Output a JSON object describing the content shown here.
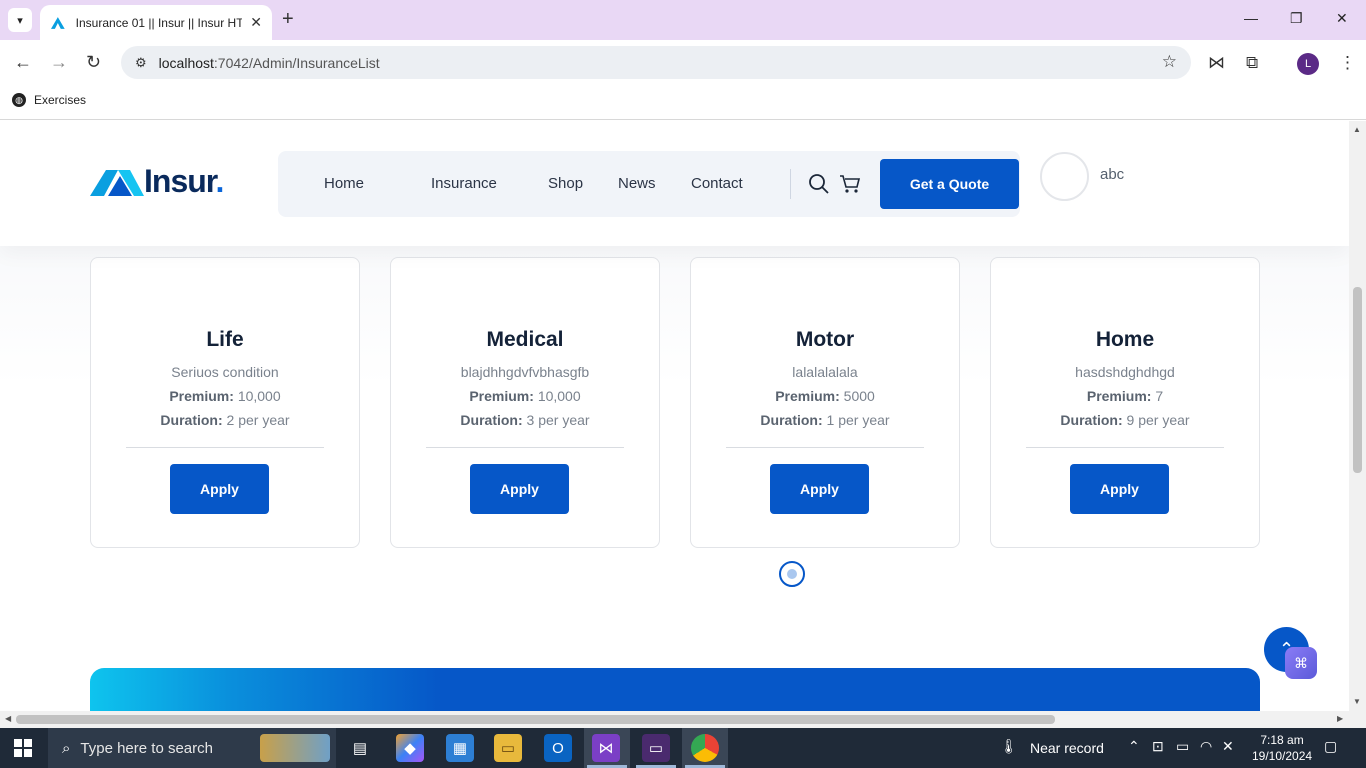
{
  "browser": {
    "tab_title": "Insurance 01 || Insur || Insur HTML",
    "url_host": "localhost",
    "url_path": ":7042/Admin/InsuranceList",
    "bookmark": "Exercises",
    "profile_initial": "L"
  },
  "site": {
    "logo_text": "Insur",
    "logo_dot": ".",
    "nav": [
      "Home",
      "Insurance",
      "Shop",
      "News",
      "Contact"
    ],
    "quote_button": "Get a Quote",
    "username": "abc"
  },
  "cards": [
    {
      "title": "Life",
      "desc": "Seriuos condition",
      "premium_label": "Premium:",
      "premium": "10,000",
      "duration_label": "Duration:",
      "duration": "2 per year",
      "button": "Apply"
    },
    {
      "title": "Medical",
      "desc": "blajdhhgdvfvbhasgfb",
      "premium_label": "Premium:",
      "premium": "10,000",
      "duration_label": "Duration:",
      "duration": "3 per year",
      "button": "Apply"
    },
    {
      "title": "Motor",
      "desc": "lalalalalala",
      "premium_label": "Premium:",
      "premium": "5000",
      "duration_label": "Duration:",
      "duration": "1 per year",
      "button": "Apply"
    },
    {
      "title": "Home",
      "desc": "hasdshdghdhgd",
      "premium_label": "Premium:",
      "premium": "7",
      "duration_label": "Duration:",
      "duration": "9 per year",
      "button": "Apply"
    }
  ],
  "taskbar": {
    "search_placeholder": "Type here to search",
    "weather": "Near record",
    "time": "7:18 am",
    "date": "19/10/2024"
  },
  "colors": {
    "brand_blue": "#0657c8",
    "tab_strip": "#e9d8f5",
    "taskbar": "#1f2a38"
  }
}
